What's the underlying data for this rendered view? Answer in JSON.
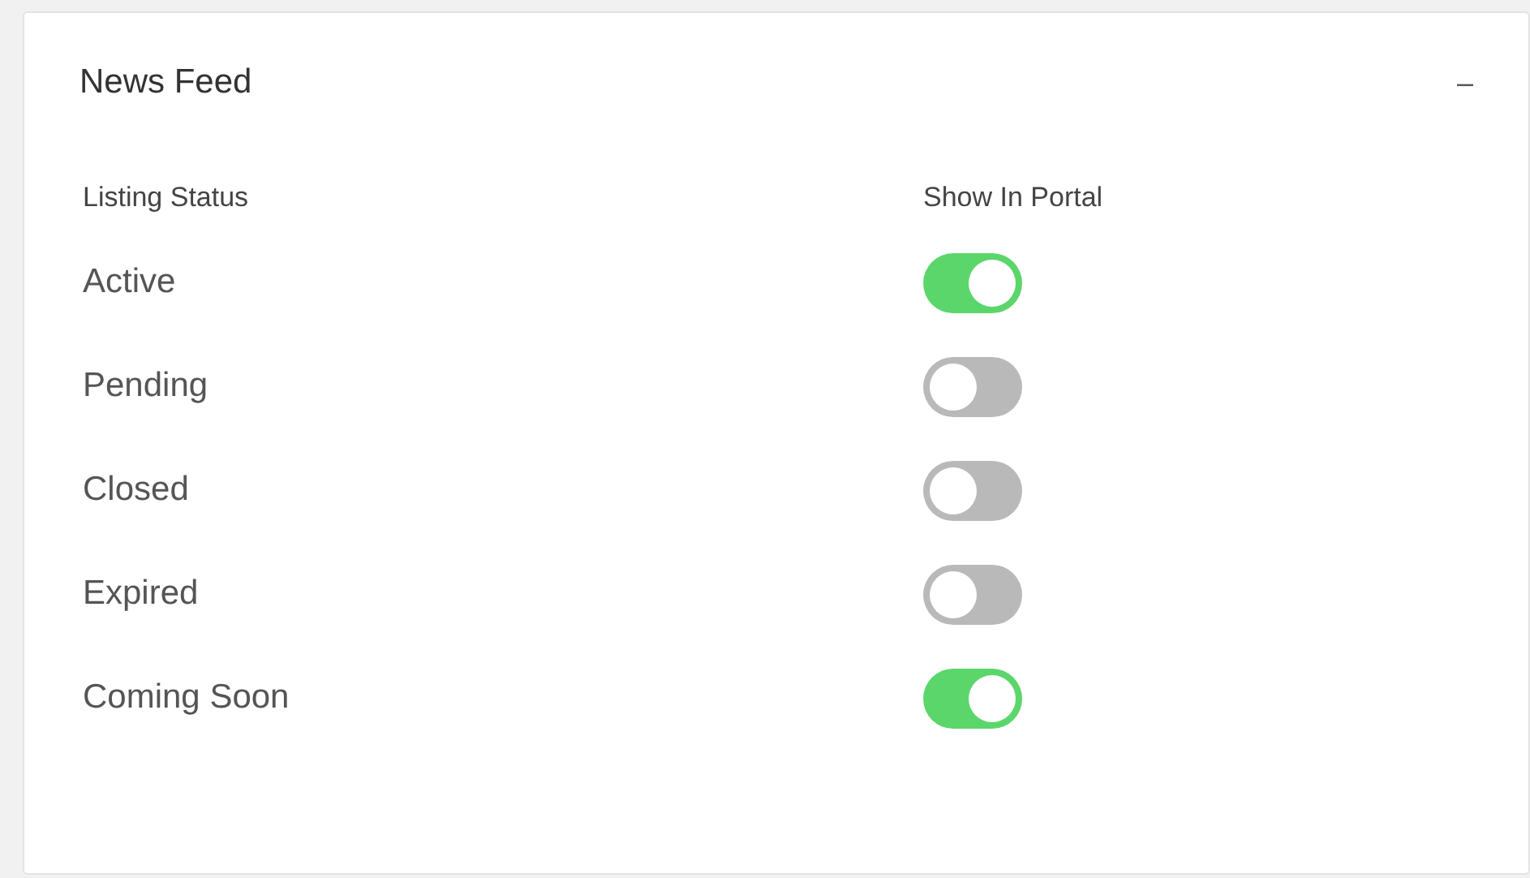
{
  "panel": {
    "title": "News Feed",
    "collapse_icon": "–"
  },
  "columns": [
    "Listing Status",
    "Show In Portal"
  ],
  "rows": [
    {
      "label": "Active",
      "on": true
    },
    {
      "label": "Pending",
      "on": false
    },
    {
      "label": "Closed",
      "on": false
    },
    {
      "label": "Expired",
      "on": false
    },
    {
      "label": "Coming Soon",
      "on": true
    }
  ]
}
